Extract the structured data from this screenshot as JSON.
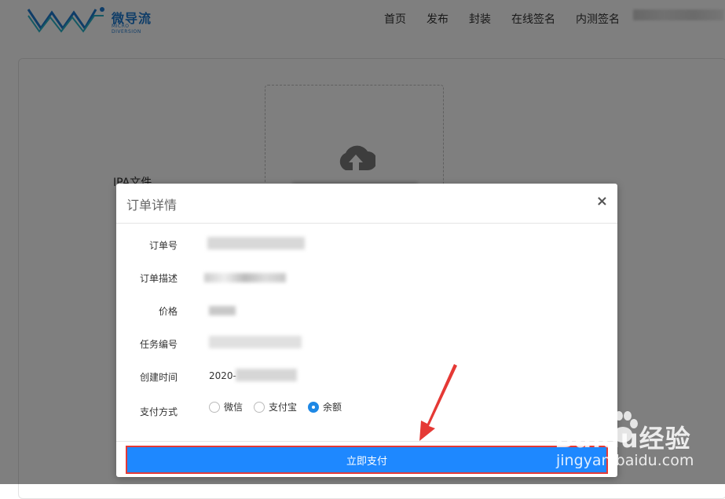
{
  "header": {
    "logo_text": "微导流",
    "logo_sub": "MICRO DIVERSION",
    "nav": [
      "首页",
      "发布",
      "封装",
      "在线签名",
      "内测签名"
    ]
  },
  "background": {
    "ipa_label": "IPA文件"
  },
  "modal": {
    "title": "订单详情",
    "close": "×",
    "fields": {
      "order_no_label": "订单号",
      "order_desc_label": "订单描述",
      "price_label": "价格",
      "task_no_label": "任务编号",
      "created_label": "创建时间",
      "created_value": "2020-",
      "payment_label": "支付方式"
    },
    "payment_options": [
      "微信",
      "支付宝",
      "余额"
    ],
    "payment_selected": "余额",
    "pay_button": "立即支付"
  },
  "watermark": {
    "line1": "Baidu经验",
    "line2": "jingyan.baidu.com"
  },
  "colors": {
    "primary": "#1e88ff",
    "highlight": "#e53935",
    "logo": "#1f7ad0"
  }
}
